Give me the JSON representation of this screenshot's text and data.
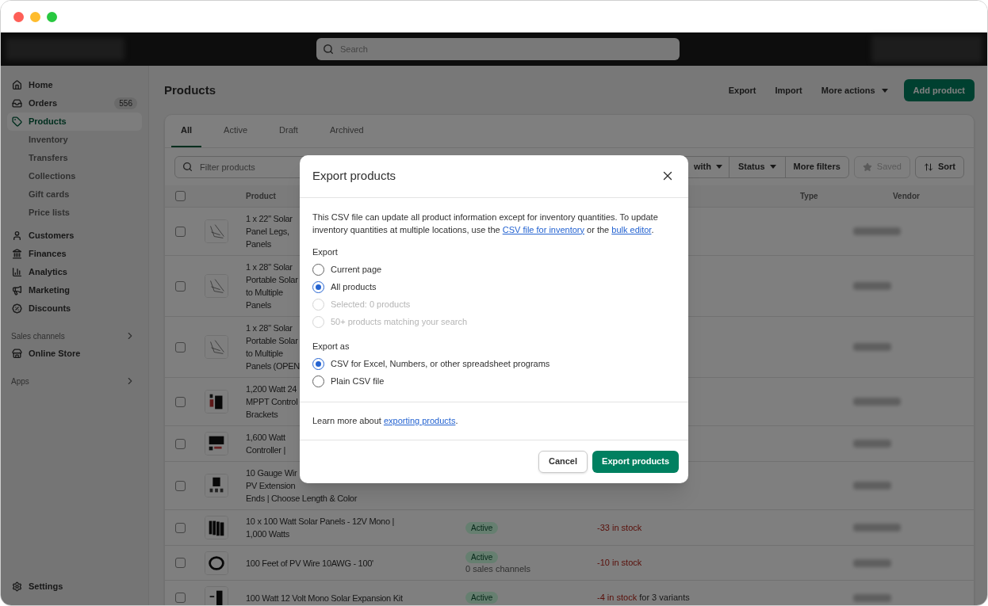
{
  "topbar": {
    "search_placeholder": "Search"
  },
  "sidebar": {
    "items": [
      {
        "label": "Home",
        "selected": false
      },
      {
        "label": "Orders",
        "selected": false,
        "badge": "556"
      },
      {
        "label": "Products",
        "selected": true,
        "children": [
          {
            "label": "Inventory"
          },
          {
            "label": "Transfers"
          },
          {
            "label": "Collections"
          },
          {
            "label": "Gift cards"
          },
          {
            "label": "Price lists"
          }
        ]
      },
      {
        "label": "Customers",
        "selected": false
      },
      {
        "label": "Finances",
        "selected": false
      },
      {
        "label": "Analytics",
        "selected": false
      },
      {
        "label": "Marketing",
        "selected": false
      },
      {
        "label": "Discounts",
        "selected": false
      }
    ],
    "sections": [
      {
        "title": "Sales channels",
        "items": [
          {
            "label": "Online Store"
          }
        ]
      },
      {
        "title": "Apps"
      }
    ],
    "settings": "Settings"
  },
  "page": {
    "title": "Products",
    "actions": [
      "Export",
      "Import"
    ],
    "more_actions": "More actions",
    "primary": "Add product"
  },
  "tabs": [
    {
      "label": "All",
      "selected": true
    },
    {
      "label": "Active",
      "selected": false
    },
    {
      "label": "Draft",
      "selected": false
    },
    {
      "label": "Archived",
      "selected": false
    }
  ],
  "filters": {
    "placeholder": "Filter products",
    "dropdowns": [
      "with",
      "Status"
    ],
    "more": "More filters",
    "saved": "Saved",
    "saved_disabled": true,
    "sort": "Sort"
  },
  "table": {
    "columns": [
      "Product",
      "Type",
      "Vendor"
    ],
    "all_checked": false,
    "rows": [
      {
        "checked": false,
        "name_lines": [
          "1 x 22\" Solar",
          "Panel Legs,",
          "Panels"
        ]
      },
      {
        "checked": false,
        "name_lines": [
          "1 x 28\" Solar",
          "Portable Solar",
          "to Multiple",
          "Panels"
        ]
      },
      {
        "checked": false,
        "name_lines": [
          "1 x 28\" Solar",
          "Portable Solar",
          "to Multiple",
          "Panels (OPEN"
        ]
      },
      {
        "checked": false,
        "name_lines": [
          "1,200 Watt 24",
          "MPPT Control",
          "Brackets"
        ]
      },
      {
        "checked": false,
        "name_lines": [
          "1,600 Watt",
          "Controller |"
        ]
      },
      {
        "checked": false,
        "name_lines": [
          "10 Gauge Wir",
          "PV Extension",
          "Ends | Choose Length & Color"
        ]
      },
      {
        "checked": false,
        "name_lines": [
          "10 x 100 Watt Solar Panels - 12V Mono |",
          "1,000 Watts"
        ],
        "status": "Active",
        "stock": "-33 in stock"
      },
      {
        "checked": false,
        "name_lines": [
          "100 Feet of PV Wire 10AWG - 100'"
        ],
        "status": "Active",
        "channels": "0 sales channels",
        "stock": "-10 in stock"
      },
      {
        "checked": false,
        "name_lines": [
          "100 Watt 12 Volt Mono Solar Expansion Kit"
        ],
        "status": "Active",
        "stock": "-4 in stock",
        "stock_note": "for 3 variants"
      }
    ]
  },
  "dialog": {
    "title": "Export products",
    "intro": {
      "text": "This CSV file can update all product information except for inventory quantities. To update inventory quantities at multiple locations, use the ",
      "link1": "CSV file for inventory",
      "middle": " or the ",
      "link2": "bulk editor",
      "end": "."
    },
    "groups": [
      {
        "label": "Export",
        "options": [
          {
            "label": "Current page",
            "selected": false,
            "disabled": false
          },
          {
            "label": "All products",
            "selected": true,
            "disabled": false
          },
          {
            "label": "Selected: 0 products",
            "selected": false,
            "disabled": true
          },
          {
            "label": "50+ products matching your search",
            "selected": false,
            "disabled": true
          }
        ]
      },
      {
        "label": "Export as",
        "options": [
          {
            "label": "CSV for Excel, Numbers, or other spreadsheet programs",
            "selected": true,
            "disabled": false
          },
          {
            "label": "Plain CSV file",
            "selected": false,
            "disabled": false
          }
        ]
      }
    ],
    "learn_more": {
      "text": "Learn more about ",
      "link": "exporting products",
      "end": "."
    },
    "buttons": {
      "cancel": "Cancel",
      "confirm": "Export products"
    }
  }
}
